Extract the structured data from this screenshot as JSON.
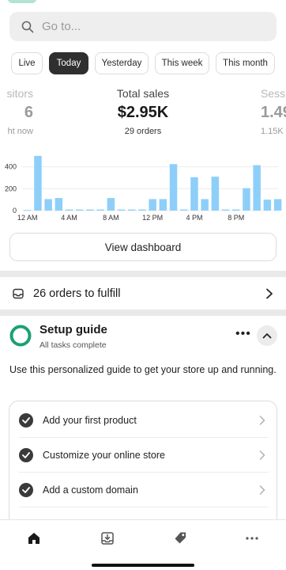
{
  "search": {
    "placeholder": "Go to..."
  },
  "tabs": [
    "Live",
    "Today",
    "Yesterday",
    "This week",
    "This month"
  ],
  "active_tab": "Today",
  "metrics": {
    "left": {
      "label": "sitors",
      "value": "6",
      "sub": "ht now"
    },
    "center": {
      "label": "Total sales",
      "value": "$2.95K",
      "sub": "29 orders"
    },
    "right": {
      "label": "Sessi",
      "value": "1.49",
      "sub": "1.15K v"
    }
  },
  "chart_data": {
    "type": "bar",
    "categories": [
      "12 AM",
      "1 AM",
      "2 AM",
      "3 AM",
      "4 AM",
      "5 AM",
      "6 AM",
      "7 AM",
      "8 AM",
      "9 AM",
      "10 AM",
      "11 AM",
      "12 PM",
      "1 PM",
      "2 PM",
      "3 PM",
      "4 PM",
      "5 PM",
      "6 PM",
      "7 PM",
      "8 PM",
      "9 PM",
      "10 PM",
      "11 PM"
    ],
    "values": [
      5,
      500,
      105,
      115,
      10,
      10,
      10,
      10,
      115,
      10,
      10,
      10,
      105,
      105,
      425,
      10,
      305,
      105,
      310,
      10,
      10,
      205,
      415,
      100,
      105
    ],
    "xticks": [
      "12 AM",
      "4 AM",
      "8 AM",
      "12 PM",
      "4 PM",
      "8 PM"
    ],
    "yticks": [
      "0",
      "200",
      "400"
    ],
    "ylim": [
      0,
      550
    ],
    "color": "#8ecff9"
  },
  "dashboard_button": "View dashboard",
  "orders": {
    "text": "26 orders to fulfill"
  },
  "setup": {
    "title": "Setup guide",
    "subtitle": "All tasks complete",
    "description": "Use this personalized guide to get your store up and running.",
    "tasks": [
      "Add your first product",
      "Customize your online store",
      "Add a custom domain"
    ]
  },
  "nav": [
    "home-icon",
    "orders-icon",
    "products-icon",
    "more-icon"
  ]
}
